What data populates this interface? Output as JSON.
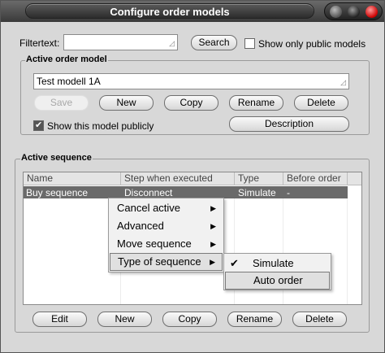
{
  "window": {
    "title": "Configure order models"
  },
  "filter": {
    "label": "Filtertext:",
    "value": "",
    "search_button": "Search",
    "public_only_label": "Show only public models",
    "public_only_checked": false
  },
  "active_model": {
    "group_title": "Active order model",
    "name_value": "Test modell 1A",
    "buttons": {
      "save": "Save",
      "new": "New",
      "copy": "Copy",
      "rename": "Rename",
      "delete": "Delete"
    },
    "show_public_label": "Show this model publicly",
    "show_public_checked": true,
    "description_button": "Description"
  },
  "active_sequence": {
    "group_title": "Active sequence",
    "columns": [
      "Name",
      "Step when executed",
      "Type",
      "Before order"
    ],
    "rows": [
      {
        "name": "Buy sequence",
        "step": "Disconnect",
        "type": "Simulate",
        "before": "-"
      }
    ],
    "buttons": {
      "edit": "Edit",
      "new": "New",
      "copy": "Copy",
      "rename": "Rename",
      "delete": "Delete"
    }
  },
  "context_menu": {
    "items": [
      "Cancel active",
      "Advanced",
      "Move sequence",
      "Type of sequence"
    ],
    "submenu": [
      "Simulate",
      "Auto order"
    ],
    "submenu_checked": "Simulate"
  }
}
